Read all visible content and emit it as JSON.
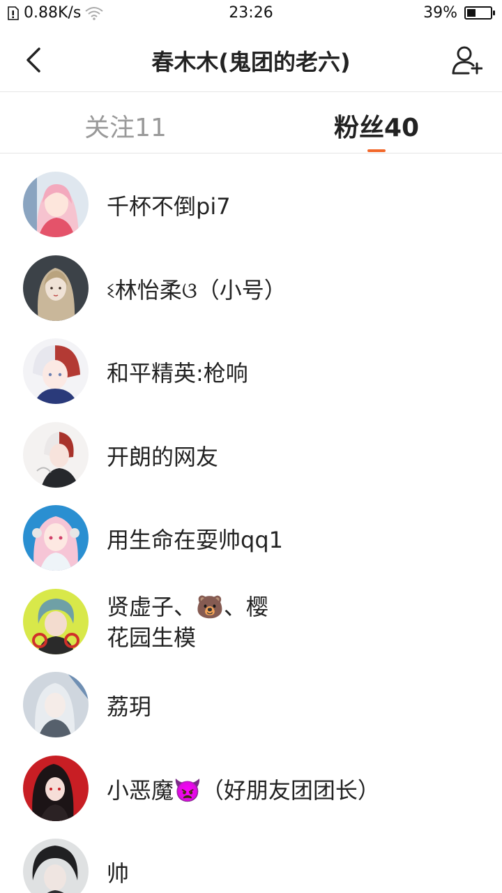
{
  "status_bar": {
    "network_speed": "0.88K/s",
    "time": "23:26",
    "battery_percent": "39%",
    "battery_level": 0.39
  },
  "header": {
    "title": "春木木(鬼团的老六)",
    "back_icon": "chevron-left-icon",
    "add_user_icon": "add-user-icon"
  },
  "tabs": [
    {
      "label": "关注11",
      "active": false
    },
    {
      "label": "粉丝40",
      "active": true
    }
  ],
  "accent_color": "#f2682a",
  "fans": [
    {
      "name": "千杯不倒pi7"
    },
    {
      "name": "ଽ林怡柔ଓ（小号）"
    },
    {
      "name": "和平精英:枪响"
    },
    {
      "name": "开朗的网友"
    },
    {
      "name": "用生命在耍帅qq1"
    },
    {
      "name": "贤虚子、🐻、樱花园生模"
    },
    {
      "name": "荔玥"
    },
    {
      "name": "小恶魔👿（好朋友团团长）"
    },
    {
      "name": "帅"
    }
  ]
}
